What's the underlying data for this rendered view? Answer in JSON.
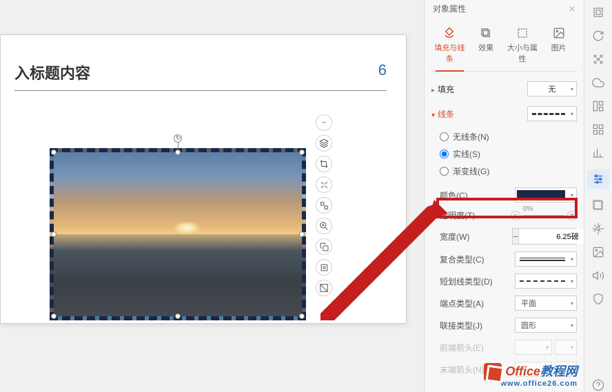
{
  "panel_title": "对象属性",
  "slide": {
    "title_placeholder": "入标题内容",
    "page_number": "6"
  },
  "tabs": {
    "fill_line": "填充与线条",
    "effects": "效果",
    "size_props": "大小与属性",
    "picture": "图片"
  },
  "fill_section": {
    "label": "填充",
    "value": "无"
  },
  "line_section": {
    "label": "线条",
    "radio_none": "无线条(N)",
    "radio_solid": "实线(S)",
    "radio_gradient": "渐变线(G)"
  },
  "props": {
    "color_label": "颜色(C)",
    "color_value": "#1a2845",
    "opacity_label": "透明度(T)",
    "opacity_value": "0%",
    "width_label": "宽度(W)",
    "width_value": "6.25磅",
    "compound_label": "复合类型(C)",
    "dash_label": "短划线类型(D)",
    "cap_label": "端点类型(A)",
    "cap_value": "平面",
    "join_label": "联接类型(J)",
    "join_value": "圆形",
    "arrow_start_label": "前端箭头(E)",
    "arrow_end_label": "末端箭头(N)"
  },
  "watermark": {
    "brand1": "Office",
    "brand2": "教程网",
    "url": "www.office26.com"
  }
}
